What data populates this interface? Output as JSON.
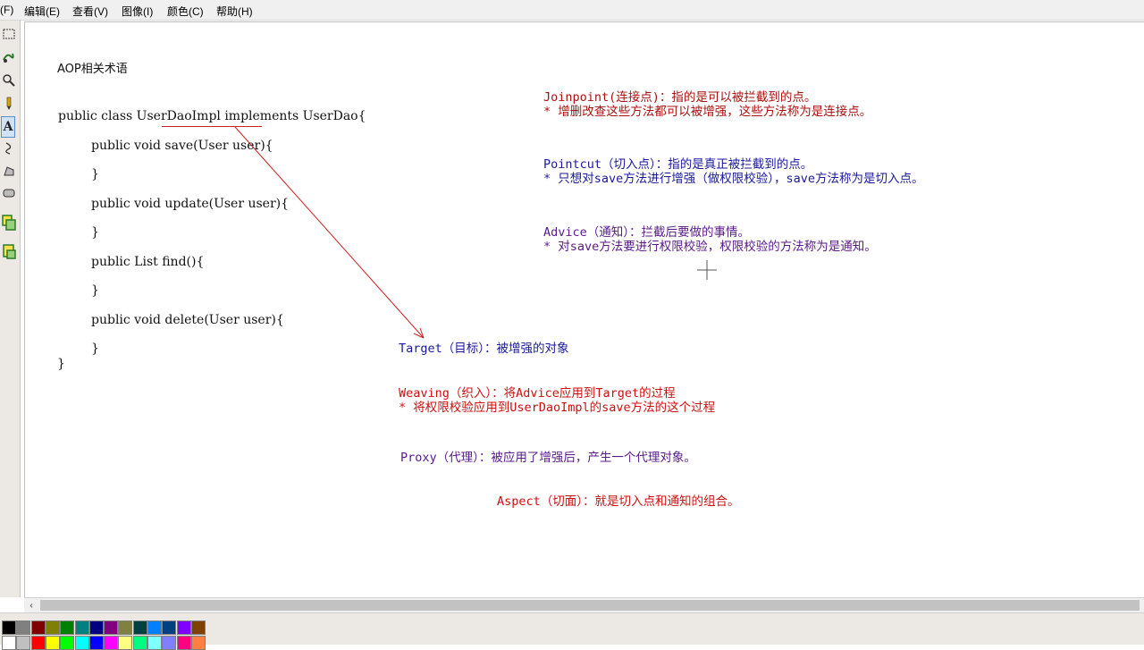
{
  "menu": {
    "items": [
      "(F)",
      "编辑(E)",
      "查看(V)",
      "图像(I)",
      "颜色(C)",
      "帮助(H)"
    ]
  },
  "tools": [
    "select-rect-icon",
    "free-select-icon",
    "magnifier-icon",
    "pencil-icon",
    "text-tool-icon",
    "curve-icon",
    "polygon-icon",
    "rounded-rect-icon",
    "copy-icon",
    "paste-icon"
  ],
  "canvas": {
    "title": "AOP相关术语",
    "code_lines": [
      "public class UserDaoImpl implements UserDao{",
      "public void save(User user){",
      "}",
      "public void update(User user){",
      "}",
      "public List find(){",
      "}",
      "public void delete(User user){",
      "}",
      "}"
    ],
    "notes": {
      "joinpoint_title": "Joinpoint(连接点)：指的是可以被拦截到的点。",
      "joinpoint_detail": "* 增删改查这些方法都可以被增强，这些方法称为是连接点。",
      "pointcut_title": "Pointcut（切入点）：指的是真正被拦截到的点。",
      "pointcut_detail": "* 只想对save方法进行增强（做权限校验），save方法称为是切入点。",
      "advice_title": "Advice（通知）：拦截后要做的事情。",
      "advice_detail": "* 对save方法要进行权限校验，权限校验的方法称为是通知。",
      "target": "Target（目标）：被增强的对象",
      "weaving_title": "Weaving（织入）：将Advice应用到Target的过程",
      "weaving_detail": "* 将权限校验应用到UserDaoImpl的save方法的这个过程",
      "proxy": "Proxy（代理）：被应用了增强后，产生一个代理对象。",
      "aspect": "Aspect（切面）：就是切入点和通知的组合。"
    }
  },
  "colors": {
    "red_note": "#cc1111",
    "darkred_note": "#aa1010",
    "blue_note": "#1a1a9a",
    "purple_note": "#5a1a8a",
    "arrow": "#cc2222"
  },
  "palette": {
    "row1": [
      "#000000",
      "#808080",
      "#800000",
      "#808000",
      "#008000",
      "#008080",
      "#000080",
      "#800080",
      "#808040",
      "#004040",
      "#0080ff",
      "#004080",
      "#8000ff",
      "#804000"
    ],
    "row2": [
      "#ffffff",
      "#c0c0c0",
      "#ff0000",
      "#ffff00",
      "#00ff00",
      "#00ffff",
      "#0000ff",
      "#ff00ff",
      "#ffff80",
      "#00ff80",
      "#80ffff",
      "#8080ff",
      "#ff0080",
      "#ff8040"
    ]
  }
}
